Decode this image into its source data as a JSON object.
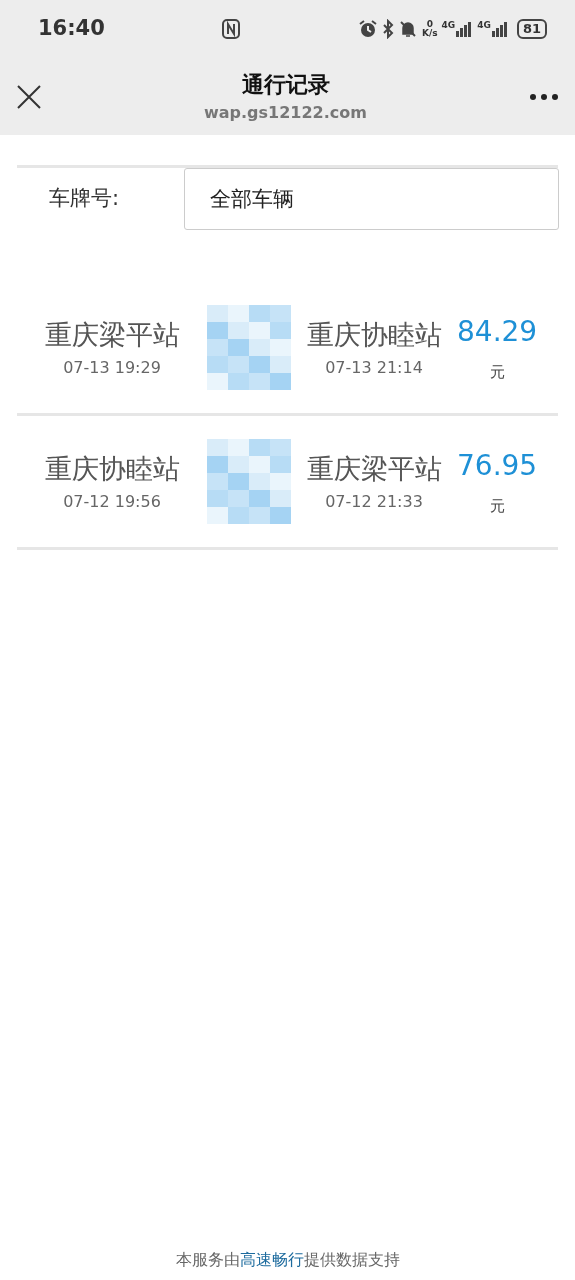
{
  "status_bar": {
    "time": "16:40",
    "speed_value": "0",
    "speed_unit": "K/s",
    "network_1": "4G",
    "network_2": "4G",
    "battery": "81"
  },
  "nav": {
    "title": "通行记录",
    "subtitle": "wap.gs12122.com"
  },
  "filter": {
    "label": "车牌号:",
    "value": "全部车辆"
  },
  "records": [
    {
      "entry_station": "重庆梁平站",
      "entry_time": "07-13 19:29",
      "exit_station": "重庆协睦站",
      "exit_time": "07-13 21:14",
      "amount": "84.29",
      "unit": "元"
    },
    {
      "entry_station": "重庆协睦站",
      "entry_time": "07-12 19:56",
      "exit_station": "重庆梁平站",
      "exit_time": "07-12 21:33",
      "amount": "76.95",
      "unit": "元"
    }
  ],
  "footer": {
    "before": "本服务由",
    "link": "高速畅行",
    "after": "提供数据支持"
  }
}
